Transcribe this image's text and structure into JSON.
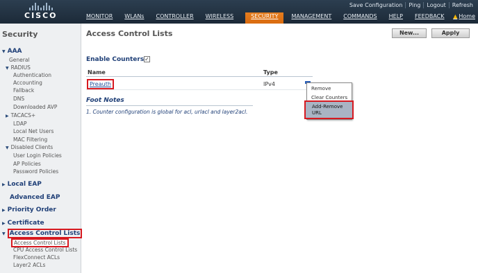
{
  "header": {
    "logo_text": "CISCO",
    "top_links": [
      "Save Configuration",
      "Ping",
      "Logout",
      "Refresh"
    ],
    "nav": [
      "MONITOR",
      "WLANs",
      "CONTROLLER",
      "WIRELESS",
      "SECURITY",
      "MANAGEMENT",
      "COMMANDS",
      "HELP",
      "FEEDBACK"
    ],
    "active_nav": "SECURITY",
    "home": "Home"
  },
  "sidebar": {
    "title": "Security",
    "aaa": "AAA",
    "general": "General",
    "radius": "RADIUS",
    "authentication": "Authentication",
    "accounting": "Accounting",
    "fallback": "Fallback",
    "dns": "DNS",
    "downloaded_avp": "Downloaded AVP",
    "tacacs": "TACACS+",
    "ldap": "LDAP",
    "local_net_users": "Local Net Users",
    "mac_filtering": "MAC Filtering",
    "disabled_clients": "Disabled Clients",
    "user_login_policies": "User Login Policies",
    "ap_policies": "AP Policies",
    "password_policies": "Password Policies",
    "local_eap": "Local EAP",
    "advanced_eap": "Advanced EAP",
    "priority_order": "Priority Order",
    "certificate": "Certificate",
    "access_control_lists": "Access Control Lists",
    "acl_sub": "Access Control Lists",
    "cpu_acl": "CPU Access Control Lists",
    "flexconnect_acls": "FlexConnect ACLs",
    "layer2_acls": "Layer2 ACLs"
  },
  "main": {
    "title": "Access Control Lists",
    "new_button": "New...",
    "apply_button": "Apply",
    "enable_counters": "Enable Counters",
    "enable_counters_checked": true,
    "col_name": "Name",
    "col_type": "Type",
    "rows": [
      {
        "name": "Preauth",
        "type": "IPv4"
      }
    ],
    "context_menu": [
      "Remove",
      "Clear Counters",
      "Add-Remove",
      "URL"
    ],
    "foot_notes_title": "Foot Notes",
    "foot_note_1": "1. Counter configuration is global for acl, urlacl and layer2acl."
  },
  "colors": {
    "header_bg": "#1f2d3b",
    "active_tab": "#e07a1a",
    "highlight_red": "#d71920",
    "link_blue": "#1f4e9a"
  }
}
